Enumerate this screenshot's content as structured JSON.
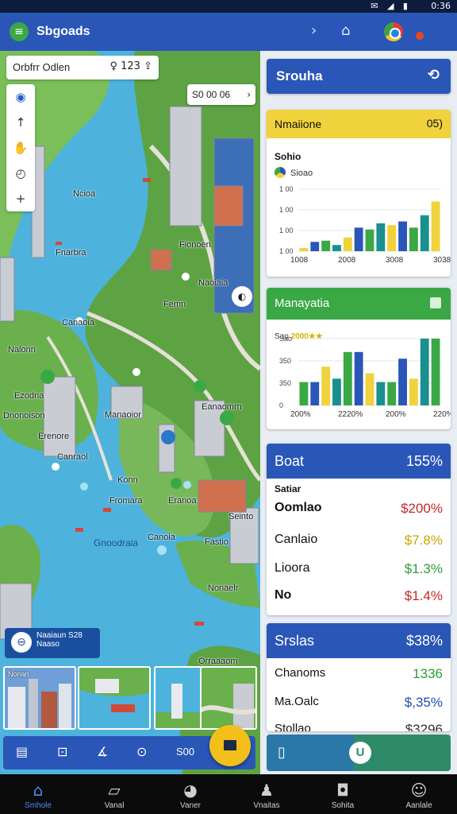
{
  "status_bar": {
    "time": "0:36",
    "icons": "✉ ◢ ▮"
  },
  "app_bar": {
    "title": "Sbgoads",
    "menu_icon": "menu-icon"
  },
  "map": {
    "search_text": "Orbfrr Odlen",
    "search_value": "123",
    "zoom_chip": "S0 00 06",
    "labels": {
      "l1": "Ncioa",
      "l2": "Fnarbra",
      "l3": "Fionoen",
      "l4": "Naoiaia",
      "l5": "Femn",
      "l6": "Canaoia",
      "l7": "Nalonn",
      "l8": "Ezodna",
      "l9": "Dnonoison",
      "l10": "Manaoior",
      "l11": "Erenore",
      "l12": "Canraol",
      "l13": "Konn",
      "l14": "Fromara",
      "l15": "Eranoa",
      "l16": "Canoia",
      "l17": "Seinto",
      "l18": "Fastio",
      "l19": "Nonaelr",
      "l20": "Eanaomrn",
      "l21": "Orraaaom"
    },
    "water_label": "Gnoodraia",
    "info_box": {
      "line1": "Naaiaun S28",
      "line2": "Naaso"
    },
    "thumb_label": "Nonan",
    "toolstrip_text": "S00"
  },
  "panel": {
    "title": "Srouha",
    "chart1": {
      "header_label": "Nmaiione",
      "header_value": "05)",
      "subtitle": "Sohio",
      "legend_text": "Sioao"
    },
    "chart2": {
      "header_label": "Manayatia",
      "legend_label": "Sao",
      "legend_value": "2000"
    },
    "table1": {
      "header_label": "Boat",
      "header_value": "155%",
      "sub_label": "Satiar",
      "rows": [
        {
          "label": "Oomlao",
          "value": "$200%",
          "color": "#c62828"
        },
        {
          "label": "Canlaio",
          "value": "$7.8%",
          "color": "#c8a800"
        },
        {
          "label": "Lioora",
          "value": "$1.3%",
          "color": "#2e9b3a"
        },
        {
          "label": "No",
          "value": "$1.4%",
          "color": "#c62828"
        }
      ]
    },
    "table2": {
      "header_label": "Srslas",
      "header_value": "$38%",
      "rows": [
        {
          "label": "Chanoms",
          "value": "1336",
          "color": "#2e9b3a"
        },
        {
          "label": "Ma.Oalc",
          "value": "$,35%",
          "color": "#1e4fb5"
        },
        {
          "label": "Stollao",
          "value": "$3296",
          "color": "#333333"
        }
      ]
    },
    "action_button_label": "U"
  },
  "bottom_nav": [
    {
      "label": "Smhole",
      "icon": "home-icon"
    },
    {
      "label": "Vanal",
      "icon": "map-icon"
    },
    {
      "label": "Vaner",
      "icon": "palette-icon"
    },
    {
      "label": "Vnaitas",
      "icon": "person-icon"
    },
    {
      "label": "Sohita",
      "icon": "shopping-bag-icon"
    },
    {
      "label": "Aanlale",
      "icon": "account-icon"
    }
  ],
  "chart_data": [
    {
      "type": "bar",
      "title": "Sohio",
      "categories": [
        "1",
        "2",
        "3",
        "4",
        "5",
        "6",
        "7",
        "8",
        "9",
        "10",
        "11",
        "12",
        "13"
      ],
      "x_tick_labels": [
        "1008",
        "2008",
        "3008",
        "3038"
      ],
      "y_tick_labels": [
        "1 00",
        "1 00",
        "1 00",
        "1 00"
      ],
      "ylim": [
        0,
        100
      ],
      "series": [
        {
          "name": "Sioao",
          "values": [
            5,
            15,
            17,
            10,
            22,
            38,
            35,
            45,
            42,
            48,
            38,
            58,
            80
          ]
        }
      ],
      "series_colors": [
        "#f0d23c",
        "#2a56b8",
        "#3aa845",
        "#1a8f8f"
      ]
    },
    {
      "type": "bar",
      "title": "Manayatia",
      "categories": [
        "1",
        "2",
        "3",
        "4",
        "5",
        "6",
        "7",
        "8",
        "9",
        "10",
        "11",
        "12",
        "13"
      ],
      "x_tick_labels": [
        "200%",
        "2220%",
        "200%",
        "220%"
      ],
      "y_tick_labels": [
        "Sao",
        "350",
        "350",
        "0"
      ],
      "ylim": [
        0,
        100
      ],
      "series": [
        {
          "name": "Sao",
          "values": [
            35,
            35,
            58,
            40,
            80,
            80,
            48,
            35,
            35,
            70,
            40,
            100,
            100
          ]
        }
      ],
      "series_colors": [
        "#3aa845",
        "#2a56b8",
        "#f0d23c",
        "#1a8f8f"
      ]
    }
  ]
}
